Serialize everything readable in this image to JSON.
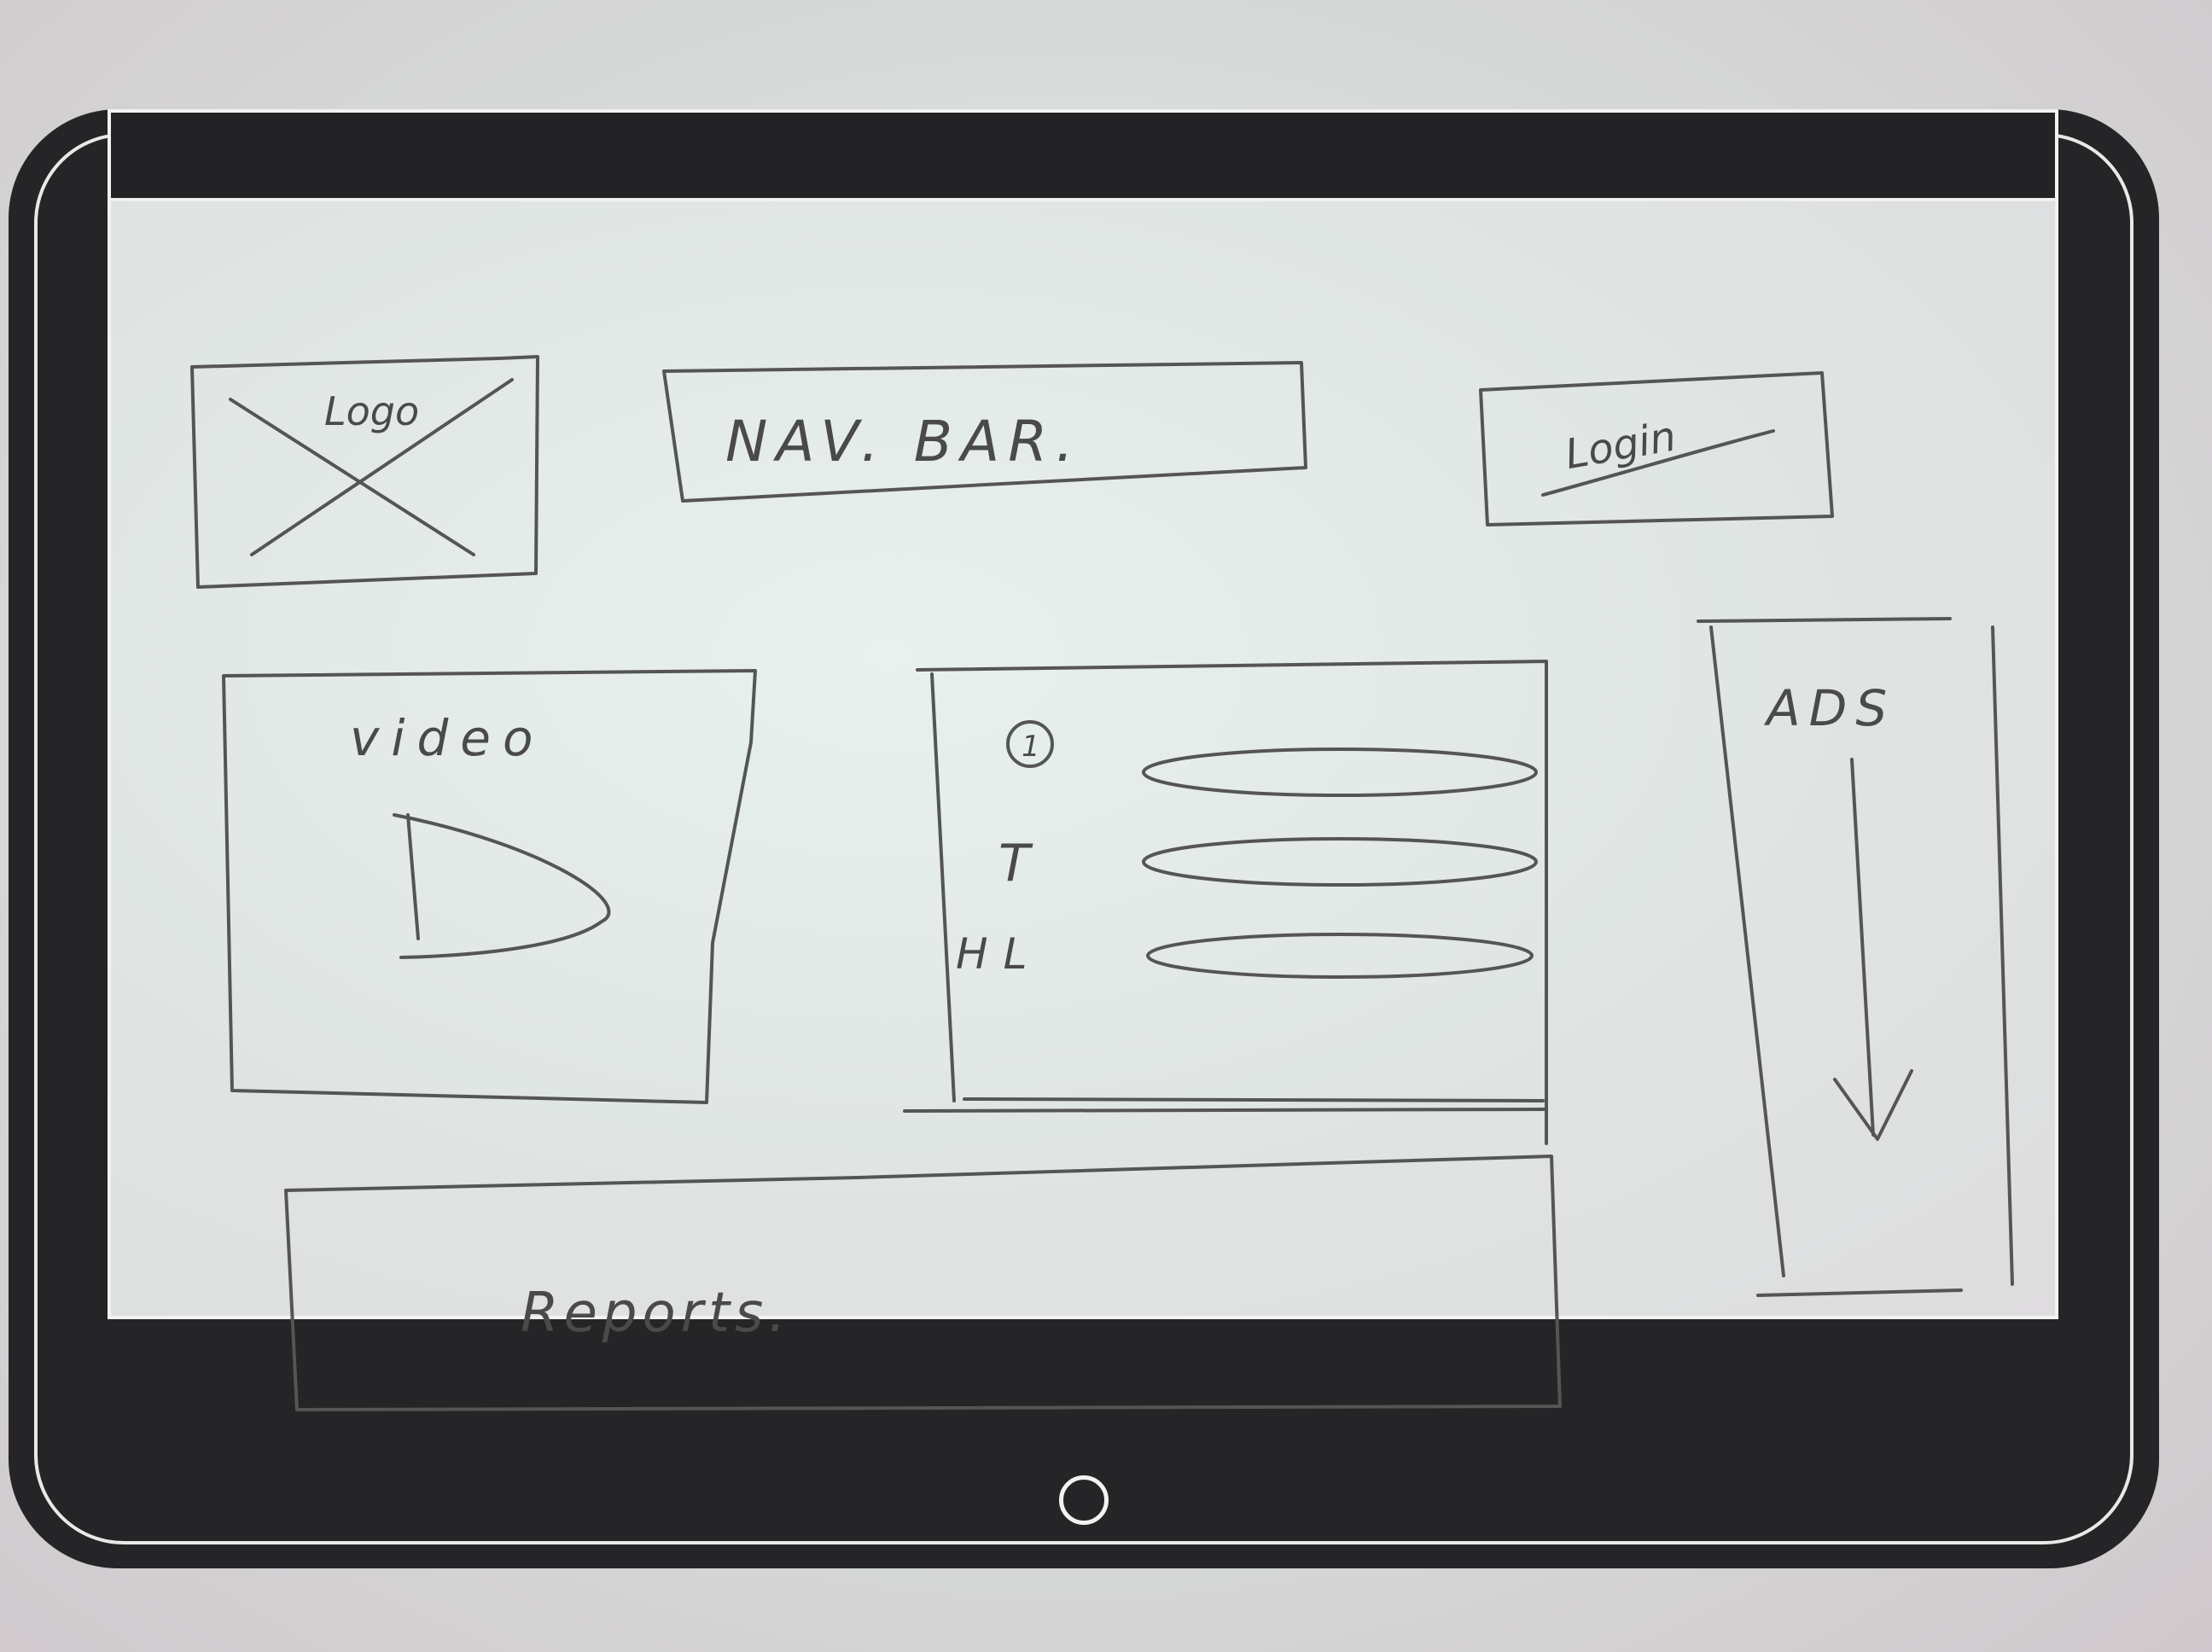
{
  "wireframe": {
    "logo_label": "Logo",
    "nav_bar_label": "NAV. BAR.",
    "login_label": "Login",
    "video_label": "video",
    "list_markers": [
      "①",
      "T",
      "HL"
    ],
    "ads_label": "ADS",
    "reports_label": "Reports."
  }
}
